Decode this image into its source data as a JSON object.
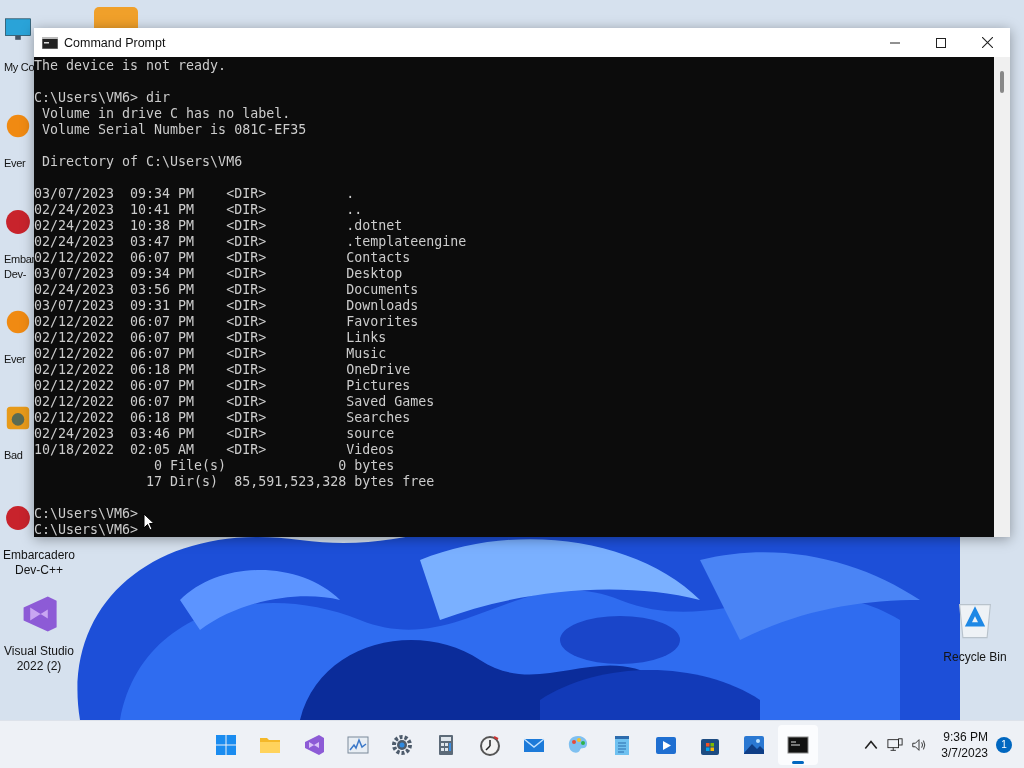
{
  "desktop_icons": [
    {
      "kind": "monitor",
      "label": [
        "My Co"
      ],
      "partly_hidden": true
    },
    {
      "kind": "orange-app",
      "label": [
        "Ever"
      ],
      "partly_hidden": true
    },
    {
      "kind": "devcpp",
      "label": [
        "Embar",
        "Dev-"
      ],
      "partly_hidden": true
    },
    {
      "kind": "orange-app",
      "label": [
        "Ever"
      ],
      "partly_hidden": true
    },
    {
      "kind": "game",
      "label": [
        "Bad"
      ],
      "partly_hidden": true
    },
    {
      "kind": "devcpp",
      "label": [
        "Embarcadero",
        "Dev-C++"
      ],
      "partly_hidden": false
    },
    {
      "kind": "vs",
      "label": [
        "Visual Studio",
        "2022 (2)"
      ],
      "partly_hidden": false
    }
  ],
  "recycle_bin": {
    "label": "Recycle Bin"
  },
  "window": {
    "title": "Command Prompt",
    "console_blocks": [
      [
        "The device is not ready."
      ],
      [
        "C:\\Users\\VM6> dir",
        " Volume in drive C has no label.",
        " Volume Serial Number is 081C-EF35"
      ],
      [
        " Directory of C:\\Users\\VM6"
      ],
      [
        "03/07/2023  09:34 PM    <DIR>          .",
        "02/24/2023  10:41 PM    <DIR>          ..",
        "02/24/2023  10:38 PM    <DIR>          .dotnet",
        "02/24/2023  03:47 PM    <DIR>          .templateengine",
        "02/12/2022  06:07 PM    <DIR>          Contacts",
        "03/07/2023  09:34 PM    <DIR>          Desktop",
        "02/24/2023  03:56 PM    <DIR>          Documents",
        "03/07/2023  09:31 PM    <DIR>          Downloads",
        "02/12/2022  06:07 PM    <DIR>          Favorites",
        "02/12/2022  06:07 PM    <DIR>          Links",
        "02/12/2022  06:07 PM    <DIR>          Music",
        "02/12/2022  06:18 PM    <DIR>          OneDrive",
        "02/12/2022  06:07 PM    <DIR>          Pictures",
        "02/12/2022  06:07 PM    <DIR>          Saved Games",
        "02/12/2022  06:18 PM    <DIR>          Searches",
        "02/24/2023  03:46 PM    <DIR>          source",
        "10/18/2022  02:05 AM    <DIR>          Videos",
        "               0 File(s)              0 bytes",
        "              17 Dir(s)  85,591,523,328 bytes free"
      ],
      [
        "C:\\Users\\VM6>",
        "C:\\Users\\VM6>"
      ]
    ]
  },
  "taskbar": {
    "apps": [
      {
        "kind": "start",
        "active": false
      },
      {
        "kind": "folder",
        "active": false
      },
      {
        "kind": "vs",
        "active": false
      },
      {
        "kind": "monitor-chart",
        "active": false
      },
      {
        "kind": "settings",
        "active": false
      },
      {
        "kind": "calculator",
        "active": false
      },
      {
        "kind": "clock",
        "active": false
      },
      {
        "kind": "mail",
        "active": false
      },
      {
        "kind": "paint",
        "active": false
      },
      {
        "kind": "notepad",
        "active": false
      },
      {
        "kind": "media",
        "active": false
      },
      {
        "kind": "store",
        "active": false
      },
      {
        "kind": "photos",
        "active": false
      },
      {
        "kind": "terminal",
        "active": true
      }
    ],
    "time": "9:36 PM",
    "date": "3/7/2023",
    "notifications": "1"
  }
}
